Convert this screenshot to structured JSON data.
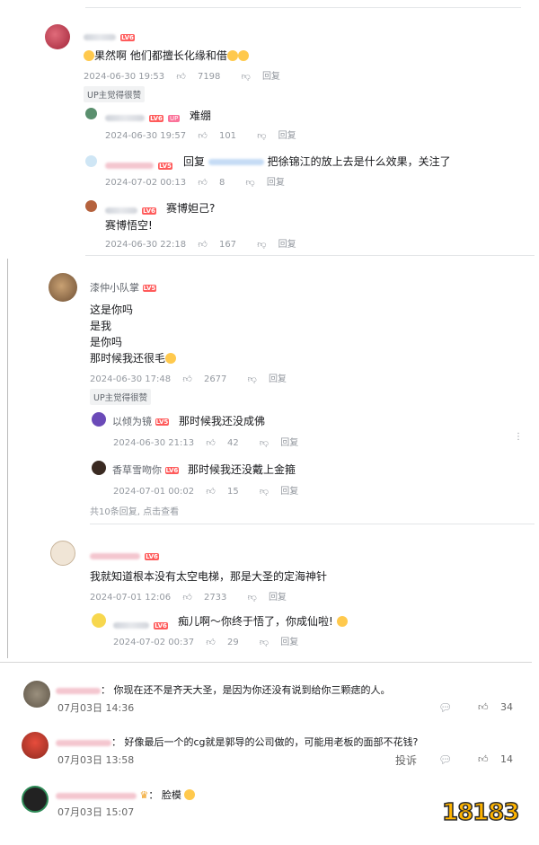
{
  "thread1": {
    "main": {
      "text": "果然啊 他们都擅长化缘和借",
      "time": "2024-06-30 19:53",
      "likes": "7198",
      "reply": "回复"
    },
    "tag": "UP主觉得很赞",
    "replies": [
      {
        "badge": "UP",
        "text": "难绷",
        "time": "2024-06-30 19:57",
        "likes": "101",
        "reply": "回复"
      },
      {
        "prefix": "回复",
        "text": "把徐锦江的放上去是什么效果，关注了",
        "time": "2024-07-02 00:13",
        "likes": "8",
        "reply": "回复"
      },
      {
        "text": "赛博妲己?",
        "text2": "赛博悟空!",
        "time": "2024-06-30 22:18",
        "likes": "167",
        "reply": "回复"
      }
    ]
  },
  "thread2": {
    "name": "漆仲小队掌",
    "lines": [
      "这是你吗",
      "是我",
      "是你吗",
      "那时候我还很毛"
    ],
    "time": "2024-06-30 17:48",
    "likes": "2677",
    "reply": "回复",
    "tag": "UP主觉得很赞",
    "replies": [
      {
        "name": "以倾为镜",
        "text": "那时候我还没成佛",
        "time": "2024-06-30 21:13",
        "likes": "42",
        "reply": "回复"
      },
      {
        "name": "香草雪吻你",
        "text": "那时候我还没戴上金箍",
        "time": "2024-07-01 00:02",
        "likes": "15",
        "reply": "回复"
      }
    ],
    "more": "共10条回复, 点击查看"
  },
  "thread3": {
    "text": "我就知道根本没有太空电梯，那是大圣的定海神针",
    "time": "2024-07-01 12:06",
    "likes": "2733",
    "reply": "回复",
    "replies": [
      {
        "text": "痴儿啊～你终于悟了，你成仙啦!",
        "time": "2024-07-02 00:37",
        "likes": "29",
        "reply": "回复"
      }
    ]
  },
  "bottom": [
    {
      "text": "你现在还不是齐天大圣，是因为你还没有说到给你三颗痣的人。",
      "date": "07月03日 14:36",
      "likes": "34"
    },
    {
      "text": "好像最后一个的cg就是郭导的公司做的，可能用老板的面部不花钱?",
      "date": "07月03日 13:58",
      "report": "投诉",
      "likes": "14"
    },
    {
      "text": "脸模",
      "date": "07月03日 15:07"
    }
  ],
  "lv6": "LV6",
  "lv5": "LV5",
  "watermark": "18183",
  "colors": {
    "accent": "#fb7299",
    "muted": "#9499a0",
    "level": "#ff5b5b"
  }
}
